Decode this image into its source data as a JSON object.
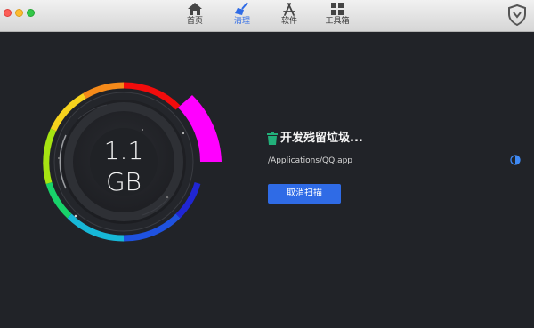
{
  "toolbar": {
    "tabs": [
      {
        "label": "首页",
        "icon": "home-icon"
      },
      {
        "label": "清理",
        "icon": "broom-icon",
        "active": true
      },
      {
        "label": "软件",
        "icon": "app-store-icon"
      },
      {
        "label": "工具箱",
        "icon": "grid-icon"
      }
    ]
  },
  "gauge": {
    "value": "1.1",
    "unit": "GB"
  },
  "status": {
    "title": "开发残留垃圾...",
    "path": "/Applications/QQ.app"
  },
  "actions": {
    "cancel_label": "取消扫描"
  },
  "colors": {
    "accent": "#2f6be6",
    "background": "#212328",
    "highlight_segment": "#ff00ff"
  }
}
